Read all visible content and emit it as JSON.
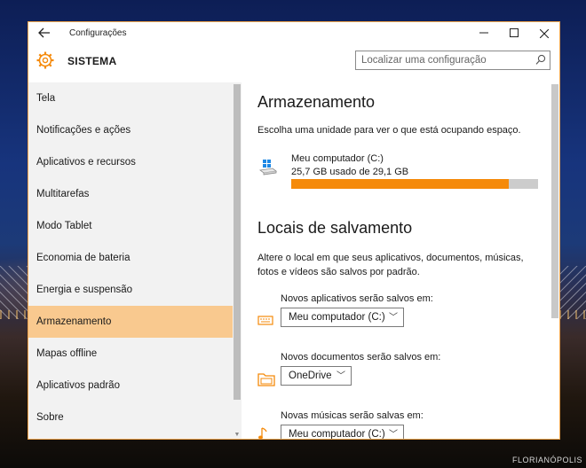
{
  "window": {
    "title": "Configurações",
    "section": "SISTEMA",
    "search_placeholder": "Localizar uma configuração"
  },
  "sidebar": {
    "items": [
      {
        "label": "Tela"
      },
      {
        "label": "Notificações e ações"
      },
      {
        "label": "Aplicativos e recursos"
      },
      {
        "label": "Multitarefas"
      },
      {
        "label": "Modo Tablet"
      },
      {
        "label": "Economia de bateria"
      },
      {
        "label": "Energia e suspensão"
      },
      {
        "label": "Armazenamento",
        "selected": true
      },
      {
        "label": "Mapas offline"
      },
      {
        "label": "Aplicativos padrão"
      },
      {
        "label": "Sobre"
      }
    ]
  },
  "storage": {
    "heading": "Armazenamento",
    "description": "Escolha uma unidade para ver o que está ocupando espaço.",
    "drive": {
      "name": "Meu computador (C:)",
      "usage": "25,7 GB usado de 29,1 GB",
      "used_fraction": 0.883
    }
  },
  "save_locations": {
    "heading": "Locais de salvamento",
    "description_line1": "Altere o local em que seus aplicativos, documentos, músicas,",
    "description_line2": "fotos e vídeos são salvos por padrão.",
    "items": [
      {
        "label": "Novos aplicativos serão salvos em:",
        "value": "Meu computador (C:)",
        "icon": "keyboard-icon"
      },
      {
        "label": "Novos documentos serão salvos em:",
        "value": "OneDrive",
        "icon": "folder-icon"
      },
      {
        "label": "Novas músicas serão salvas em:",
        "value": "Meu computador (C:)",
        "icon": "music-note-icon"
      }
    ]
  },
  "colors": {
    "accent": "#f58a0a",
    "selection": "#f9c98f",
    "window_border": "#f0a44b"
  },
  "watermark": "FLORIANÓPOLIS"
}
